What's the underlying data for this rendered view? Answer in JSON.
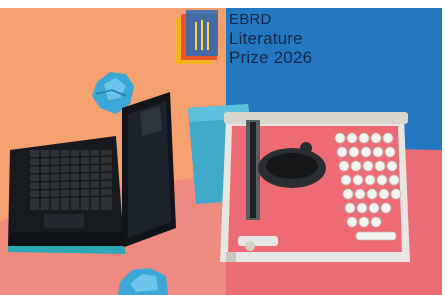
{
  "brand": {
    "line1": "EBRD",
    "line2": "Literature",
    "line3": "Prize 2026"
  },
  "colors": {
    "left_background": "#f5a06f",
    "right_background": "#2378c1",
    "tabletop": "#ef6f75",
    "logo_text": "#14284b"
  },
  "icons": [
    "ebrd-book-logo-icon",
    "laptop-icon",
    "typewriter-icon",
    "crumpled-paper-icon"
  ]
}
